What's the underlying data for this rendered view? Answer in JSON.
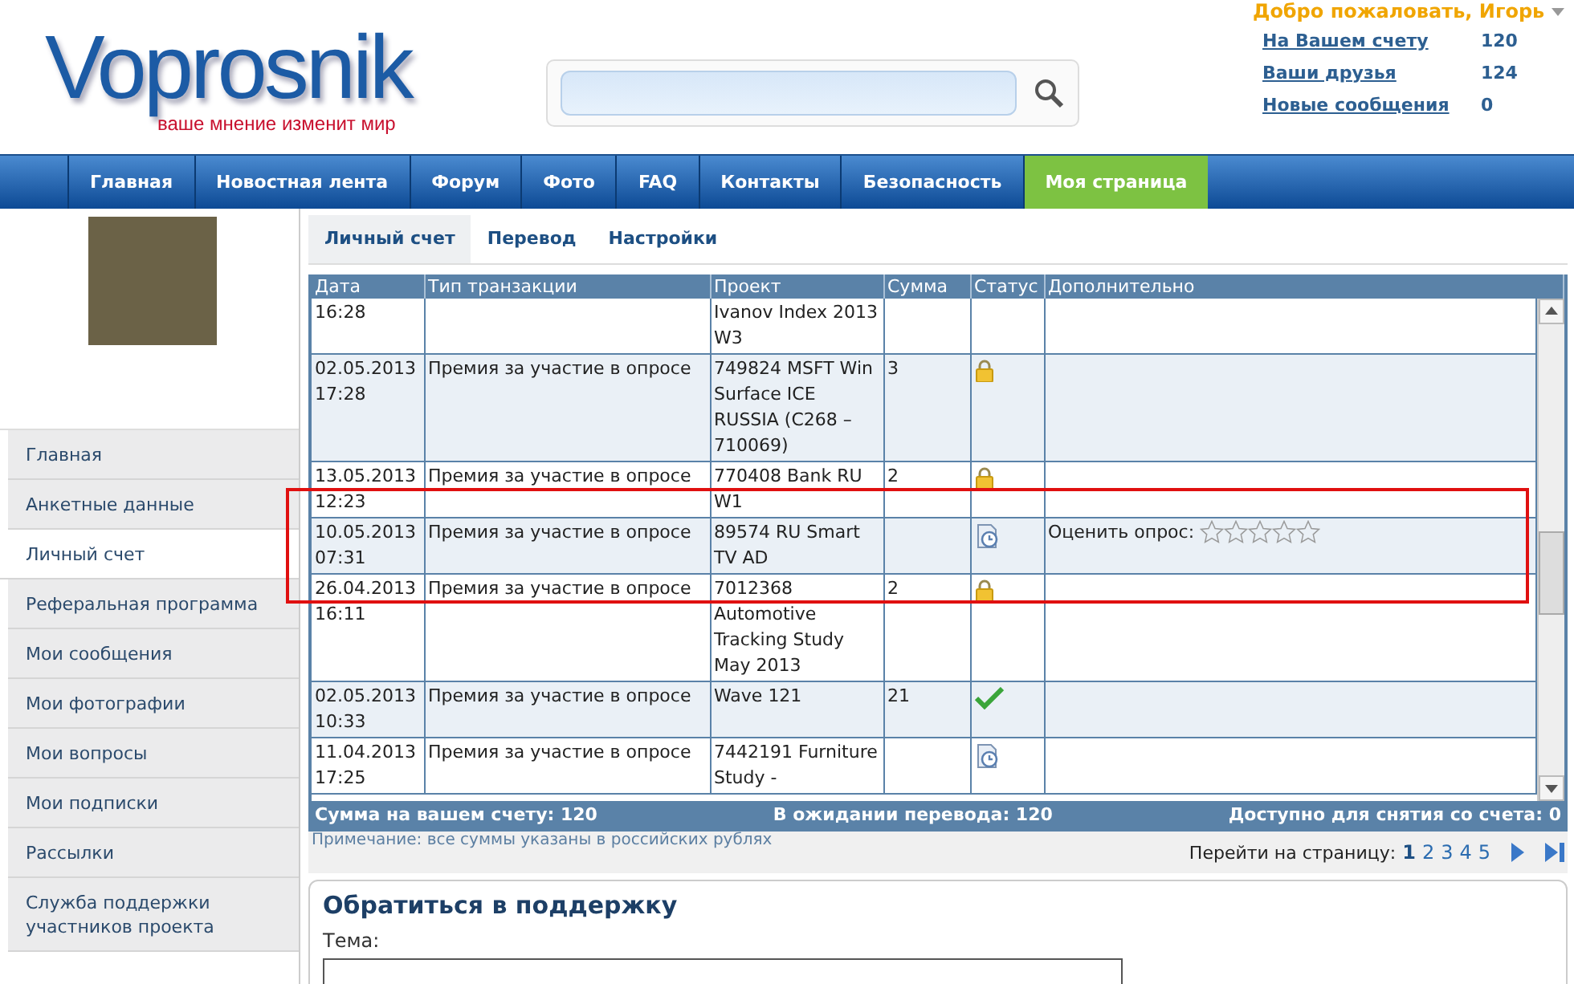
{
  "logo": {
    "name": "Voprosnik",
    "tagline": "ваше мнение изменит мир"
  },
  "user": {
    "greeting": "Добро пожаловать, Игорь",
    "stats": [
      {
        "label": "На Вашем счету",
        "value": "120"
      },
      {
        "label": "Ваши друзья",
        "value": "124"
      },
      {
        "label": "Новые сообщения",
        "value": "0"
      }
    ]
  },
  "nav": [
    {
      "label": "Главная",
      "selected": false
    },
    {
      "label": "Новостная лента",
      "selected": false
    },
    {
      "label": "Форум",
      "selected": false
    },
    {
      "label": "Фото",
      "selected": false
    },
    {
      "label": "FAQ",
      "selected": false
    },
    {
      "label": "Контакты",
      "selected": false
    },
    {
      "label": "Безопасность",
      "selected": false
    },
    {
      "label": "Моя страница",
      "selected": true
    }
  ],
  "sidebar": {
    "items": [
      {
        "label": "Главная",
        "selected": false
      },
      {
        "label": "Анкетные данные",
        "selected": false
      },
      {
        "label": "Личный счет",
        "selected": true
      },
      {
        "label": "Реферальная программа",
        "selected": false
      },
      {
        "label": "Мои сообщения",
        "selected": false
      },
      {
        "label": "Мои фотографии",
        "selected": false
      },
      {
        "label": "Мои вопросы",
        "selected": false
      },
      {
        "label": "Мои подписки",
        "selected": false
      },
      {
        "label": "Рассылки",
        "selected": false
      },
      {
        "label": "Служба поддержки участников проекта",
        "selected": false
      }
    ]
  },
  "tabs": [
    {
      "label": "Личный счет",
      "selected": true
    },
    {
      "label": "Перевод",
      "selected": false
    },
    {
      "label": "Настройки",
      "selected": false
    }
  ],
  "table": {
    "columns": [
      "Дата",
      "Тип транзакции",
      "Проект",
      "Сумма",
      "Статус",
      "Дополнительно"
    ],
    "rows": [
      {
        "date": "16:28",
        "type": "",
        "project": "Ivanov Index 2013 W3",
        "amount": "",
        "kind": "plain"
      },
      {
        "date": "02.05.2013 17:28",
        "type": "Премия за участие в опросе",
        "project": "749824 MSFT Win Surface ICE RUSSIA (C268 – 710069)",
        "amount": "3",
        "kind": "locked"
      },
      {
        "date": "13.05.2013 12:23",
        "type": "Премия за участие в опросе",
        "project": "770408 Bank RU W1",
        "amount": "2",
        "kind": "locked"
      },
      {
        "date": "10.05.2013 07:31",
        "type": "Премия за участие в опросе",
        "project": "89574 RU Smart TV AD",
        "amount": "",
        "kind": "pending",
        "rating": {
          "label": "Оценить опрос:",
          "stars": 0
        }
      },
      {
        "date": "26.04.2013 16:11",
        "type": "Премия за участие в опросе",
        "project": "7012368 Automotive Tracking Study May 2013",
        "amount": "2",
        "kind": "locked"
      },
      {
        "date": "02.05.2013 10:33",
        "type": "Премия за участие в опросе",
        "project": "Wave 121",
        "amount": "21",
        "kind": "paid"
      },
      {
        "date": "11.04.2013 17:25",
        "type": "Премия за участие в опросе",
        "project": "7442191 Furniture Study -",
        "amount": "",
        "kind": "pending"
      }
    ],
    "totals": [
      "Сумма на вашем счету: 120",
      "В ожидании перевода: 120",
      "Доступно для снятия со счета: 0"
    ]
  },
  "note": "Примечание: все суммы указаны в российских рублях",
  "pagination": {
    "label": "Перейти на страницу:",
    "pages": [
      {
        "label": "1",
        "selected": true
      },
      {
        "label": "2",
        "selected": false
      },
      {
        "label": "3",
        "selected": false
      },
      {
        "label": "4",
        "selected": false
      },
      {
        "label": "5",
        "selected": false
      }
    ]
  },
  "support": {
    "title": "Обратиться в поддержку",
    "subject_label": "Тема:"
  }
}
